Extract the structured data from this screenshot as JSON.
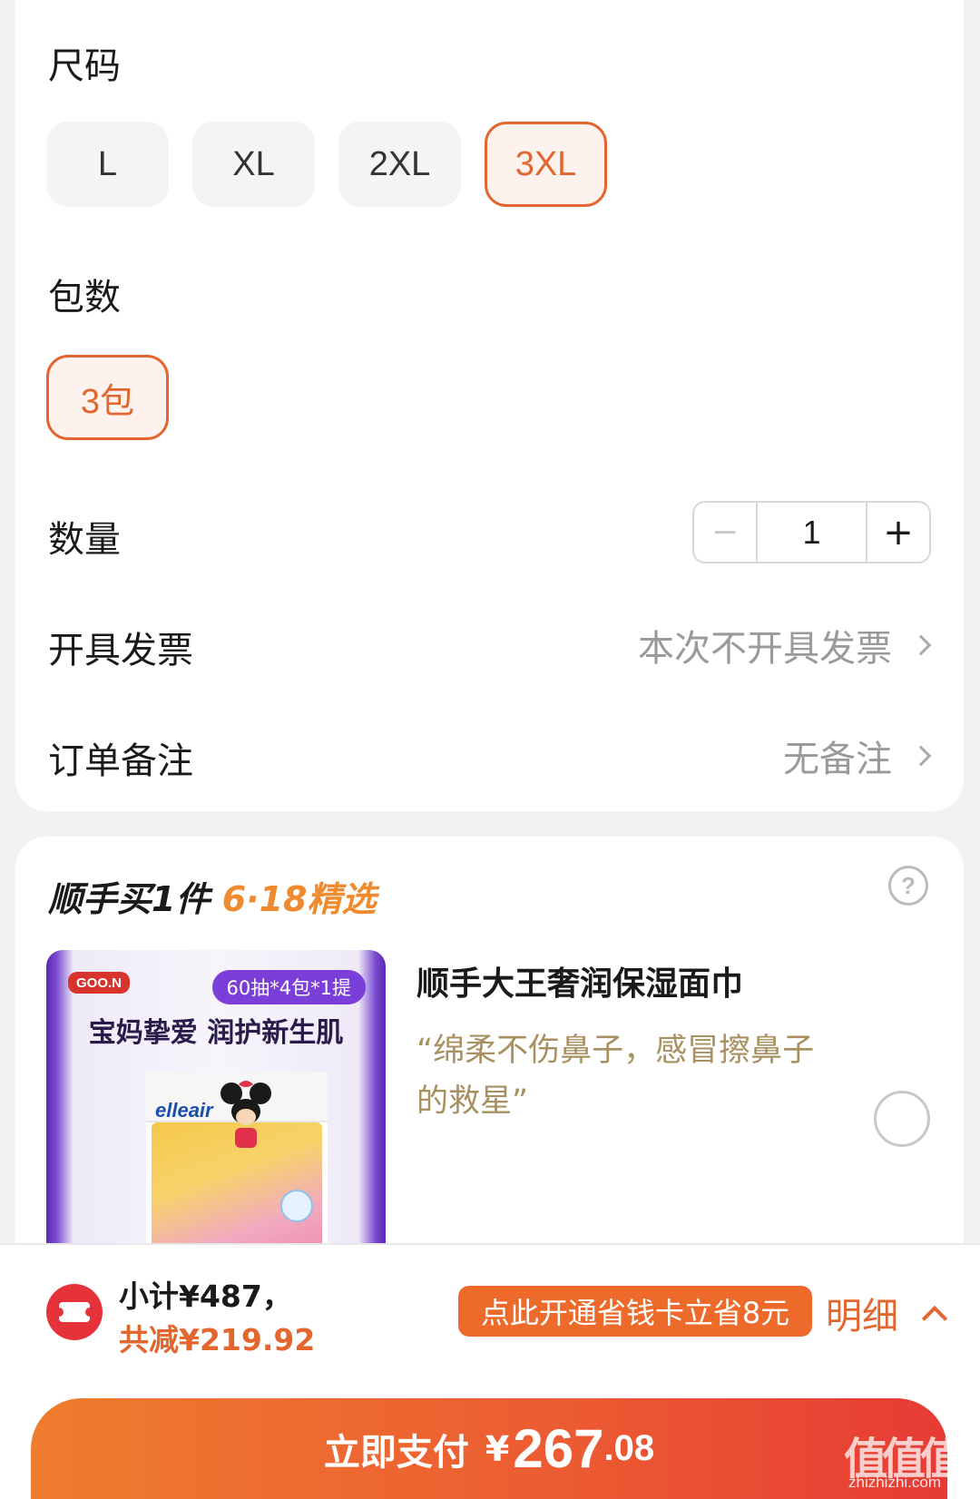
{
  "size_section": {
    "label": "尺码",
    "options": [
      "L",
      "XL",
      "2XL",
      "3XL"
    ],
    "selected": "3XL"
  },
  "pack_section": {
    "label": "包数",
    "options": [
      "3包"
    ],
    "selected": "3包"
  },
  "quantity": {
    "label": "数量",
    "minus": "−",
    "value": "1",
    "plus": "+"
  },
  "invoice": {
    "label": "开具发票",
    "value": "本次不开具发票"
  },
  "remark": {
    "label": "订单备注",
    "value": "无备注"
  },
  "recommend": {
    "title_prefix": "顺手买1件",
    "title_highlight": "6·18精选",
    "help": "?",
    "product": {
      "badge": "60抽*4包*1提",
      "brand_logo": "GOO.N",
      "slogan": "宝妈挚爱 润护新生肌",
      "pack_logo": "elleair",
      "name": "顺手大王奢润保湿面巾",
      "desc": "“绵柔不伤鼻子，感冒擦鼻子的救星”",
      "selected": false
    }
  },
  "summary": {
    "subtotal": "小计¥487，",
    "discount": "共减¥219.92",
    "promo": "点此开通省钱卡立省8元",
    "detail": "明细"
  },
  "pay": {
    "label": "立即支付",
    "currency": "¥",
    "amount_int": "267",
    "amount_dec": ".08"
  },
  "watermark": {
    "text": "值值值",
    "sub": "zhizhizhi.com"
  },
  "colors": {
    "accent": "#e2662e",
    "pay_start": "#ef7d2e",
    "pay_end": "#e63b35",
    "promo_bg": "#ee6a2a"
  }
}
